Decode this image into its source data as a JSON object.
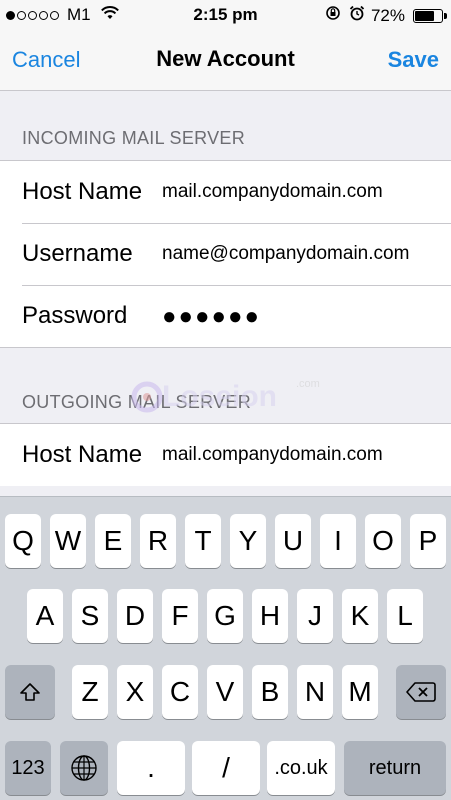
{
  "status_bar": {
    "carrier": "M1",
    "time": "2:15 pm",
    "battery": "72%",
    "battery_level": 0.72,
    "signal_bars_filled": 1,
    "signal_bars_total": 5
  },
  "nav": {
    "cancel": "Cancel",
    "title": "New Account",
    "save": "Save"
  },
  "incoming": {
    "header": "INCOMING MAIL SERVER",
    "rows": [
      {
        "label": "Host Name",
        "value": "mail.companydomain.com"
      },
      {
        "label": "Username",
        "value": "name@companydomain.com"
      },
      {
        "label": "Password",
        "value": "●●●●●●"
      }
    ]
  },
  "outgoing": {
    "header": "OUTGOING MAIL SERVER",
    "rows": [
      {
        "label": "Host Name",
        "value": "mail.companydomain.com"
      }
    ]
  },
  "watermark": {
    "text": "Loseion",
    "suffix": ".com"
  },
  "keyboard": {
    "row1": [
      "Q",
      "W",
      "E",
      "R",
      "T",
      "Y",
      "U",
      "I",
      "O",
      "P"
    ],
    "row2": [
      "A",
      "S",
      "D",
      "F",
      "G",
      "H",
      "J",
      "K",
      "L"
    ],
    "row3": [
      "Z",
      "X",
      "C",
      "V",
      "B",
      "N",
      "M"
    ],
    "numbers": "123",
    "dot": ".",
    "slash": "/",
    "couk": ".co.uk",
    "return": "return"
  },
  "colors": {
    "accent": "#1a85e0",
    "background": "#efeff4",
    "keyboard": "#d1d5db"
  }
}
